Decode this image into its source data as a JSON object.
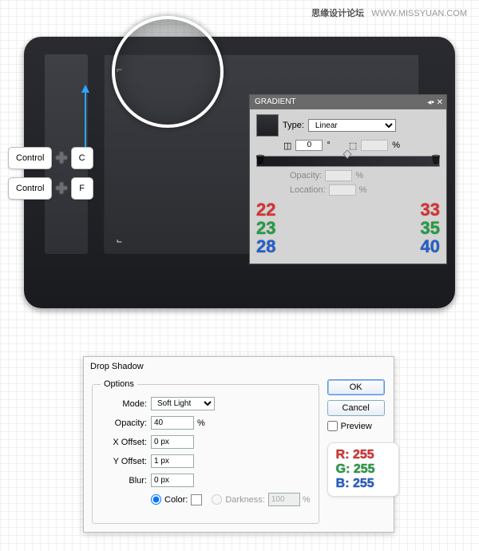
{
  "watermark": {
    "cn": "思缘设计论坛",
    "url": "WWW.MISSYUAN.COM"
  },
  "keys": {
    "row1_left": "Control",
    "row1_right": "C",
    "row2_left": "Control",
    "row2_right": "F"
  },
  "gradient_panel": {
    "title": "GRADIENT",
    "type_label": "Type:",
    "type_value": "Linear",
    "angle": "0",
    "ratio": "",
    "percent": "%",
    "opacity_label": "Opacity:",
    "location_label": "Location:",
    "stops": {
      "left": {
        "r": "22",
        "g": "23",
        "b": "28"
      },
      "right": {
        "r": "33",
        "g": "35",
        "b": "40"
      }
    }
  },
  "dialog": {
    "title": "Drop Shadow",
    "legend": "Options",
    "mode_label": "Mode:",
    "mode_value": "Soft Light",
    "opacity_label": "Opacity:",
    "opacity_value": "40",
    "opacity_unit": "%",
    "xoff_label": "X Offset:",
    "xoff_value": "0 px",
    "yoff_label": "Y Offset:",
    "yoff_value": "1 px",
    "blur_label": "Blur:",
    "blur_value": "0 px",
    "color_label": "Color:",
    "darkness_label": "Darkness:",
    "darkness_value": "100",
    "ok": "OK",
    "cancel": "Cancel",
    "preview": "Preview",
    "rgb": {
      "r": "R: 255",
      "g": "G: 255",
      "b": "B: 255"
    }
  }
}
